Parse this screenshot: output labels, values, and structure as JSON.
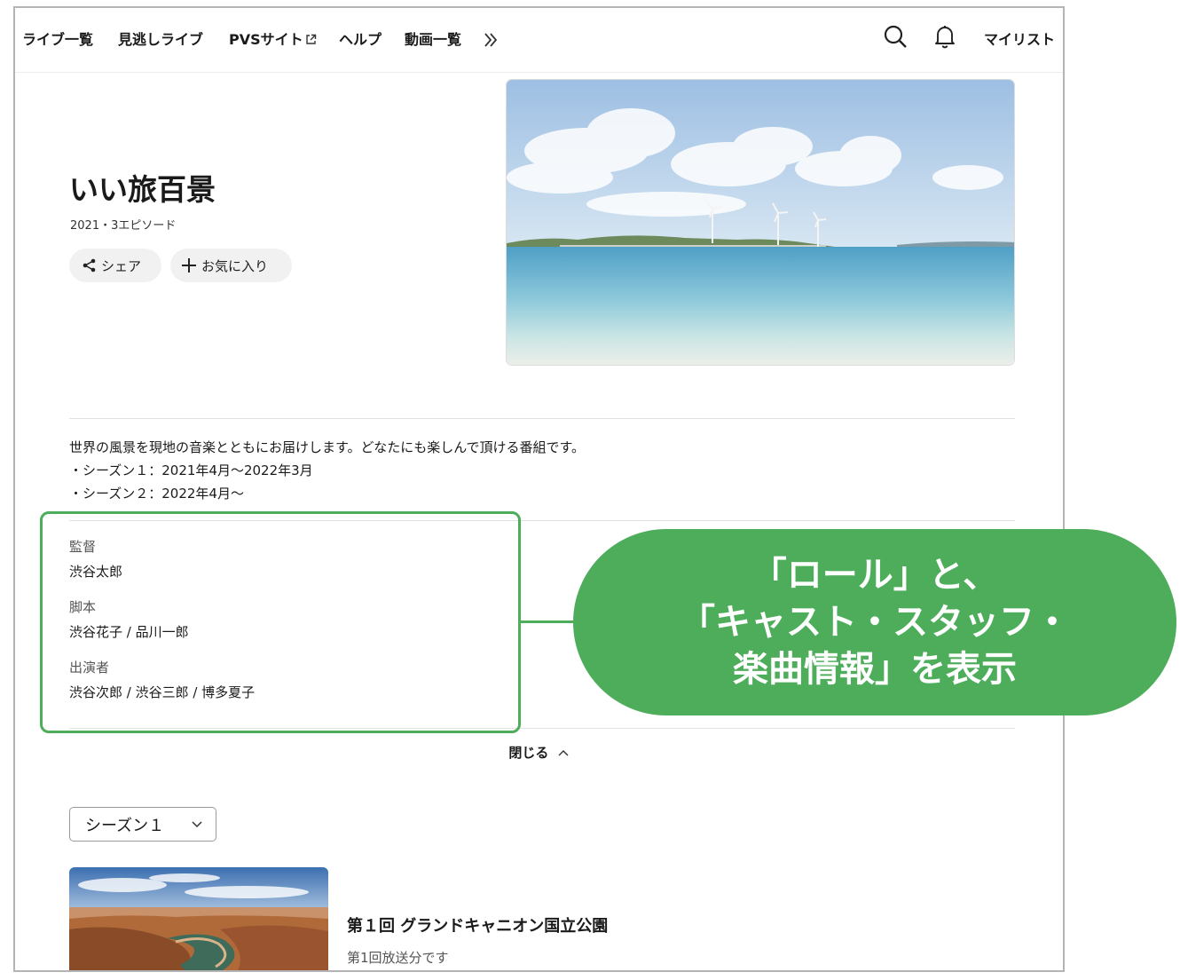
{
  "nav": {
    "items": [
      "ライブ一覧",
      "見逃しライブ",
      "PVSサイト",
      "ヘルプ",
      "動画一覧"
    ],
    "more_icon": "double-chevron-right-icon",
    "search_icon": "search-icon",
    "bell_icon": "bell-icon",
    "mylist": "マイリスト"
  },
  "program": {
    "title": "いい旅百景",
    "meta": "2021・3エピソード",
    "share_label": "シェア",
    "favorite_label": "お気に入り"
  },
  "description": [
    "世界の風景を現地の音楽とともにお届けします。どなたにも楽しんで頂ける番組です。",
    "・シーズン１：2021年4月〜2022年3月",
    "・シーズン２：2022年4月〜"
  ],
  "credits": [
    {
      "role": "監督",
      "names": "渋谷太郎"
    },
    {
      "role": "脚本",
      "names": "渋谷花子 / 品川一郎"
    },
    {
      "role": "出演者",
      "names": "渋谷次郎 / 渋谷三郎 / 博多夏子"
    }
  ],
  "close_label": "閉じる",
  "season_select": {
    "selected": "シーズン１"
  },
  "episode": {
    "title": "第１回 グランドキャニオン国立公園",
    "subtitle": "第1回放送分です"
  },
  "annotation": {
    "lines": [
      "「ロール」と、",
      "「キャスト・スタッフ・",
      "楽曲情報」を表示"
    ],
    "color": "#4ead5b"
  }
}
